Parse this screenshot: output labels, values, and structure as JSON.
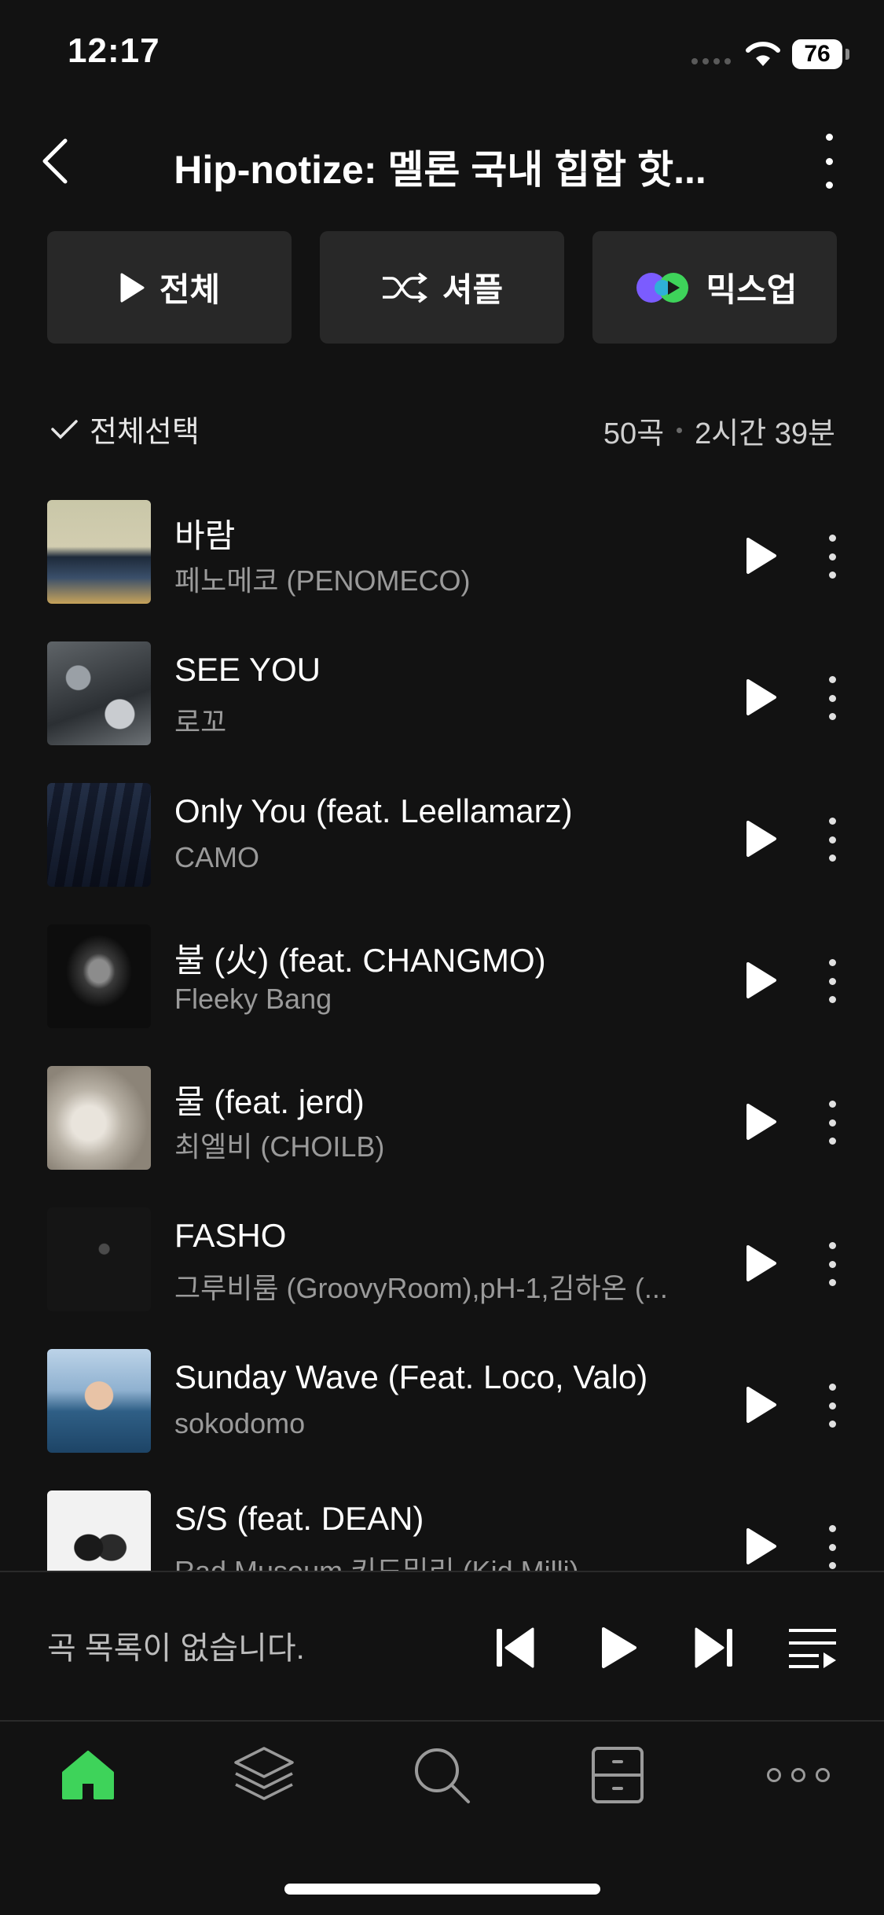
{
  "status_bar": {
    "time": "12:17",
    "battery": "76"
  },
  "header": {
    "title": "Hip-notize: 멜론 국내 힙합 핫..."
  },
  "actions": {
    "play_all": "전체",
    "shuffle": "셔플",
    "mixup": "믹스업"
  },
  "list_header": {
    "select_all": "전체선택",
    "count": "50곡",
    "duration": "2시간 39분"
  },
  "songs": [
    {
      "title": "바람",
      "artist": "페노메코 (PENOMECO)"
    },
    {
      "title": "SEE YOU",
      "artist": "로꼬"
    },
    {
      "title": "Only You (feat. Leellamarz)",
      "artist": "CAMO"
    },
    {
      "title": "불 (火) (feat. CHANGMO)",
      "artist": "Fleeky Bang"
    },
    {
      "title": "물 (feat. jerd)",
      "artist": "최엘비 (CHOILB)"
    },
    {
      "title": "FASHO",
      "artist": "그루비룸 (GroovyRoom),pH-1,김하온 (..."
    },
    {
      "title": "Sunday Wave (Feat. Loco, Valo)",
      "artist": "sokodomo"
    },
    {
      "title": "S/S (feat. DEAN)",
      "artist": "Rad Museum,키드밀리 (Kid Milli)"
    }
  ],
  "player": {
    "empty_text": "곡 목록이 없습니다."
  },
  "colors": {
    "accent": "#3ed35a",
    "background": "#121212",
    "button": "#282828"
  }
}
